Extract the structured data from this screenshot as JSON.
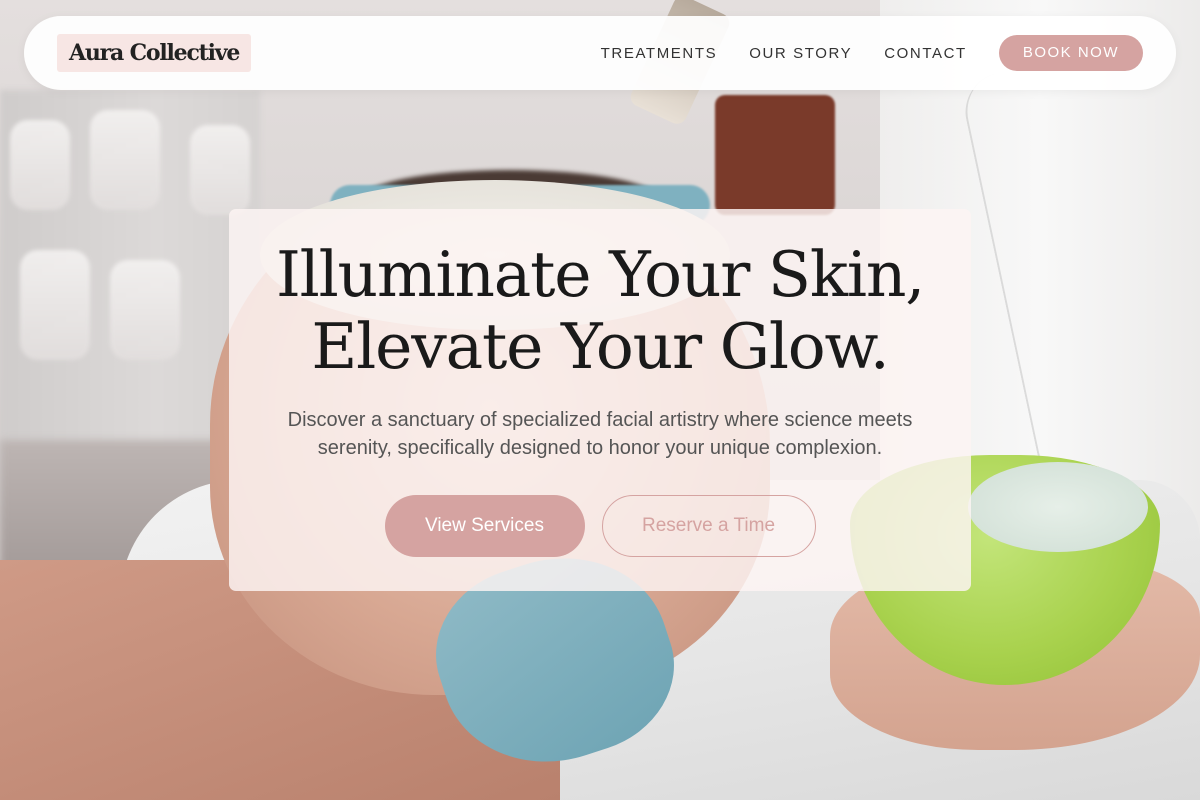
{
  "brand": {
    "name": "Aura Collective"
  },
  "nav": {
    "items": [
      {
        "label": "TREATMENTS"
      },
      {
        "label": "OUR STORY"
      },
      {
        "label": "CONTACT"
      }
    ],
    "cta_label": "BOOK NOW"
  },
  "hero": {
    "title_line1": "Illuminate Your Skin,",
    "title_line2": "Elevate Your Glow.",
    "subtitle": "Discover a sanctuary of specialized facial artistry where science meets serenity, specifically designed to honor your unique complexion.",
    "primary_button": "View Services",
    "secondary_button": "Reserve a Time"
  },
  "colors": {
    "accent": "#d5a3a1",
    "card_background": "#fdf4f3",
    "brand_highlight": "#f7e6e4",
    "heading_text": "#1a1a1a",
    "body_text": "#555555"
  }
}
